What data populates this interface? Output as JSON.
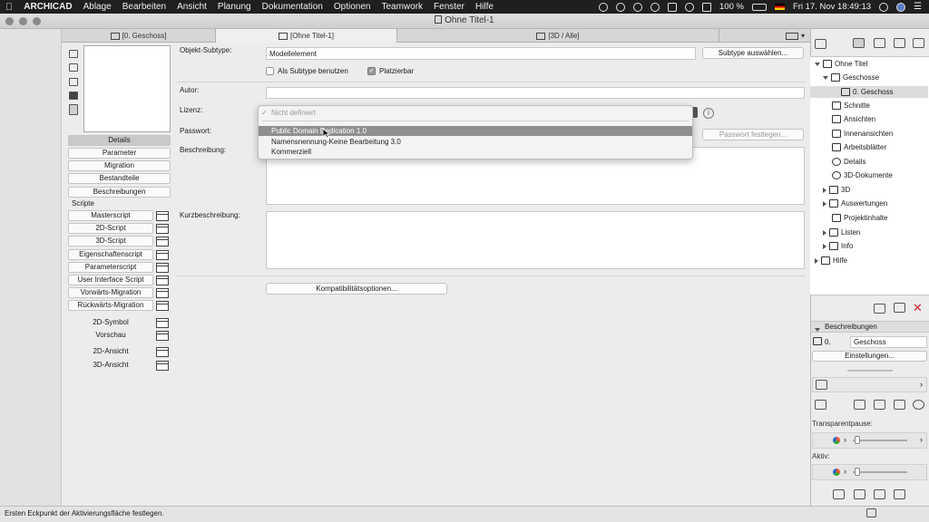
{
  "menubar": {
    "apple": "",
    "items": [
      "ARCHICAD",
      "Ablage",
      "Bearbeiten",
      "Ansicht",
      "Planung",
      "Dokumentation",
      "Optionen",
      "Teamwork",
      "Fenster",
      "Hilfe"
    ],
    "battery": "100 %",
    "datetime": "Fri 17. Nov  18:49:13"
  },
  "window": {
    "title": "Ohne Titel-1"
  },
  "tabs": [
    "[0. Geschoss]",
    "[Ohne Titel-1]",
    "[3D / Alle]"
  ],
  "left": {
    "nav_buttons": [
      "Details",
      "Parameter",
      "Migration",
      "Bestandteile",
      "Beschreibungen"
    ],
    "scripts_label": "Scripte",
    "scripts": [
      "Masterscript",
      "2D-Script",
      "3D-Script",
      "Eigenschaftenscript",
      "Parameterscript",
      "User Interface Script",
      "Vorwärts-Migration",
      "Rückwärts-Migration"
    ],
    "views": [
      "2D-Symbol",
      "Vorschau",
      "2D-Ansicht",
      "3D-Ansicht"
    ]
  },
  "form": {
    "subtype_label": "Objekt-Subtype:",
    "subtype_value": "Modellelement",
    "subtype_button": "Subtype auswählen...",
    "use_subtype_label": "Als Subtype benutzen",
    "placeable_label": "Platzierbar",
    "placeable_mark": "✓",
    "author_label": "Autor:",
    "license_label": "Lizenz:",
    "password_label": "Passwort:",
    "password_button": "Passwort festlegen...",
    "description_label": "Beschreibung:",
    "short_description_label": "Kurzbeschreibung:",
    "compat_button": "Kompatibilitätsoptionen..."
  },
  "license_dropdown": {
    "checked_option": "Nicht definiert",
    "options": [
      "Public Domain Dedication 1.0",
      "Namensnennung-Keine Bearbeitung 3.0",
      "Kommerziell"
    ],
    "highlighted_index": 0
  },
  "navigator": {
    "root": "Ohne Titel",
    "items": [
      "Geschosse",
      "0. Geschoss",
      "Schnitte",
      "Ansichten",
      "Innenansichten",
      "Arbeitsblätter",
      "Details",
      "3D-Dokumente",
      "3D",
      "Auswertungen",
      "Projektinhalte",
      "Listen",
      "Info",
      "Hilfe"
    ]
  },
  "inspector": {
    "section_title": "Beschreibungen",
    "story_number": "0.",
    "story_name": "Geschoss",
    "settings_button": "Einstellungen...",
    "transparent_pause_label": "Transparentpause:",
    "active_label": "Aktiv:"
  },
  "status": {
    "text": "Ersten Eckpunkt der Aktivierungsfläche festlegen."
  }
}
